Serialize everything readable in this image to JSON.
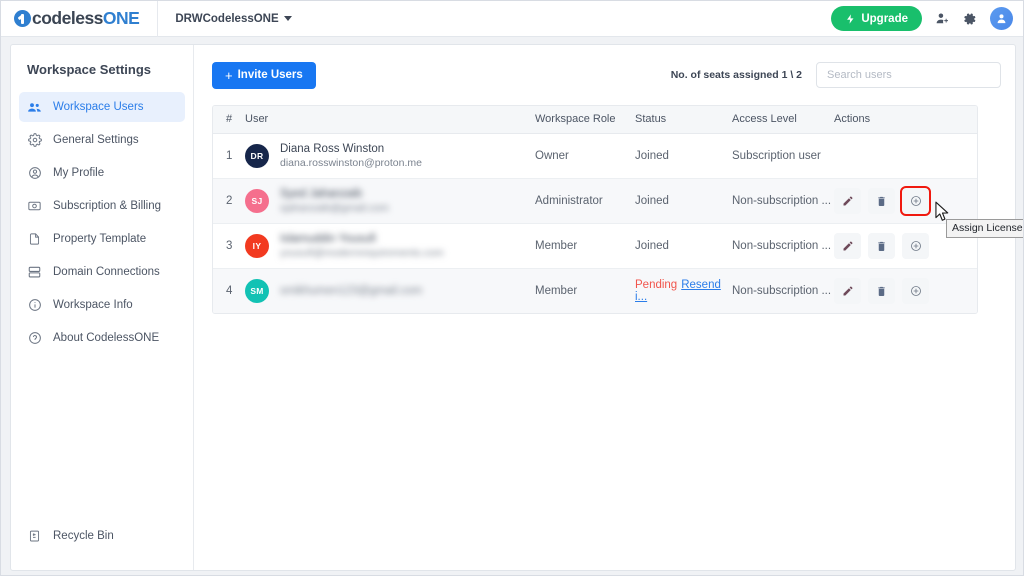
{
  "topbar": {
    "logo_primary": "codeless",
    "logo_accent": "ONE",
    "workspace_name": "DRWCodelessONE",
    "upgrade_label": "Upgrade",
    "icons": {
      "bolt": "bolt-icon",
      "add_user": "add-user-icon",
      "settings": "gear-icon",
      "account": "account-avatar-icon"
    }
  },
  "sidebar": {
    "title": "Workspace Settings",
    "items": [
      {
        "label": "Workspace Users",
        "icon": "users-icon",
        "active": true
      },
      {
        "label": "General Settings",
        "icon": "gear-icon",
        "active": false
      },
      {
        "label": "My Profile",
        "icon": "user-circle-icon",
        "active": false
      },
      {
        "label": "Subscription & Billing",
        "icon": "billing-icon",
        "active": false
      },
      {
        "label": "Property Template",
        "icon": "document-icon",
        "active": false
      },
      {
        "label": "Domain Connections",
        "icon": "server-icon",
        "active": false
      },
      {
        "label": "Workspace Info",
        "icon": "info-icon",
        "active": false
      },
      {
        "label": "About CodelessONE",
        "icon": "about-icon",
        "active": false
      }
    ],
    "recycle_bin": {
      "label": "Recycle Bin",
      "icon": "recycle-bin-icon"
    }
  },
  "toolbar": {
    "invite_label": "Invite Users",
    "invite_plus": "+",
    "seats_text": "No. of seats assigned 1 \\ 2",
    "search_placeholder": "Search users",
    "search_value": ""
  },
  "table": {
    "columns": [
      "#",
      "User",
      "Workspace Role",
      "Status",
      "Access Level",
      "Actions"
    ],
    "rows": [
      {
        "num": "1",
        "initials": "DR",
        "avatar_color": "#16264a",
        "name": "Diana Ross Winston",
        "email": "diana.rosswinston@proton.me",
        "redacted": false,
        "role": "Owner",
        "status": "Joined",
        "status_pending": false,
        "resend_label": "",
        "access": "Subscription user",
        "has_actions": false
      },
      {
        "num": "2",
        "initials": "SJ",
        "avatar_color": "#f56f8d",
        "name": "Syed Jahanzaib",
        "email": "sjahanzaib@gmail.com",
        "redacted": true,
        "role": "Administrator",
        "status": "Joined",
        "status_pending": false,
        "resend_label": "",
        "access": "Non-subscription ...",
        "has_actions": true
      },
      {
        "num": "3",
        "initials": "IY",
        "avatar_color": "#f23a20",
        "name": "Islamuddin Yousufi",
        "email": "yousufi@modernrequirements.com",
        "redacted": true,
        "role": "Member",
        "status": "Joined",
        "status_pending": false,
        "resend_label": "",
        "access": "Non-subscription ...",
        "has_actions": true
      },
      {
        "num": "4",
        "initials": "SM",
        "avatar_color": "#12c2b4",
        "name": "",
        "email": "smikhumen123@gmail.com",
        "redacted": true,
        "role": "Member",
        "status": "Pending",
        "status_pending": true,
        "resend_label": "Resend i...",
        "access": "Non-subscription ...",
        "has_actions": true
      }
    ],
    "action_icons": [
      "edit-pencil-icon",
      "delete-trash-icon",
      "assign-license-icon"
    ]
  },
  "tooltip": {
    "text": "Assign License"
  },
  "colors": {
    "accent_blue": "#1877f2",
    "upgrade_green": "#19bf6c",
    "active_nav_bg": "#e8f0fd",
    "active_nav_text": "#2b7de9",
    "pending_red": "#f1554c",
    "highlight_red": "#f0190f"
  }
}
